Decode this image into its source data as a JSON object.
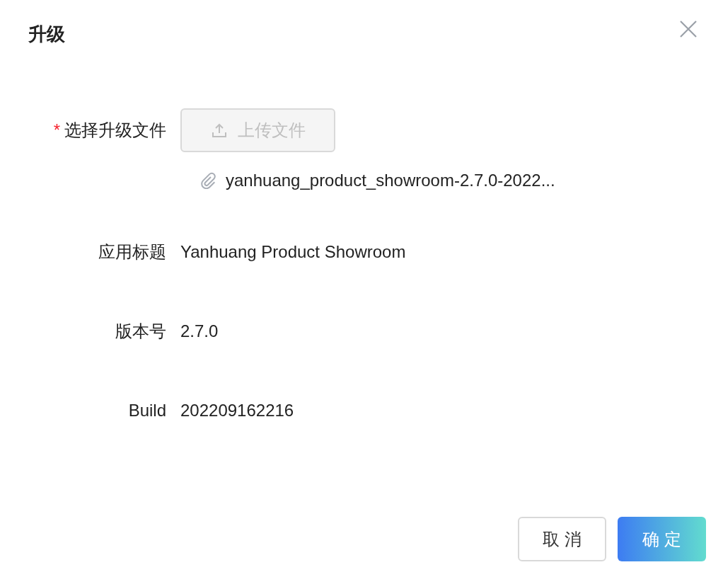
{
  "dialog": {
    "title": "升级"
  },
  "fields": [
    {
      "kind": "upload",
      "label": "选择升级文件",
      "required_mark": "*",
      "button": {
        "label": "上传文件",
        "disabled": true
      },
      "file": "yanhuang_product_showroom-2.7.0-2022..."
    },
    {
      "kind": "text",
      "label": "应用标题",
      "value": "Yanhuang Product Showroom"
    },
    {
      "kind": "text",
      "label": "版本号",
      "value": "2.7.0"
    },
    {
      "kind": "text",
      "label": "Build",
      "value": "202209162216"
    }
  ],
  "buttons": [
    {
      "kind": "secondary",
      "label": "取 消"
    },
    {
      "kind": "primary",
      "label": "确 定"
    }
  ]
}
